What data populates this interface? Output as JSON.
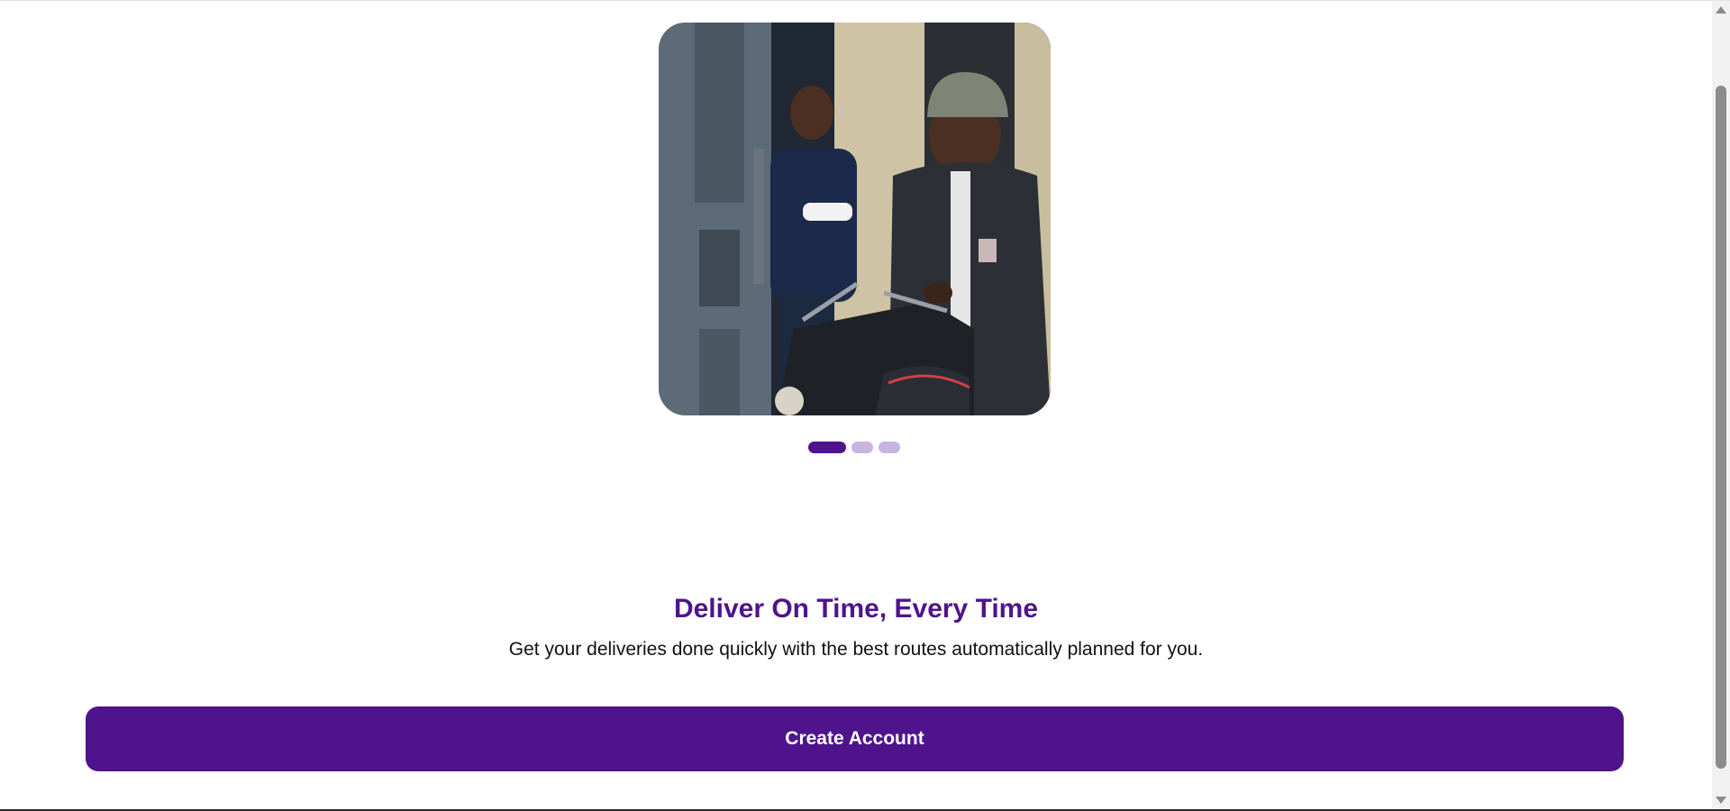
{
  "onboarding": {
    "hero_image": {
      "alt": "Delivery rider on a motorcycle handing a food package to a customer at a doorway"
    },
    "carousel": {
      "slide_count": 3,
      "active_index": 0,
      "active_color": "#4f148c",
      "inactive_color": "#c9b3e0"
    },
    "headline": "Deliver On Time, Every Time",
    "subtext": "Get your deliveries done quickly with the best routes automatically planned for you.",
    "cta_label": "Create Account"
  },
  "colors": {
    "brand": "#4f148c",
    "text": "#111111",
    "background": "#ffffff"
  }
}
